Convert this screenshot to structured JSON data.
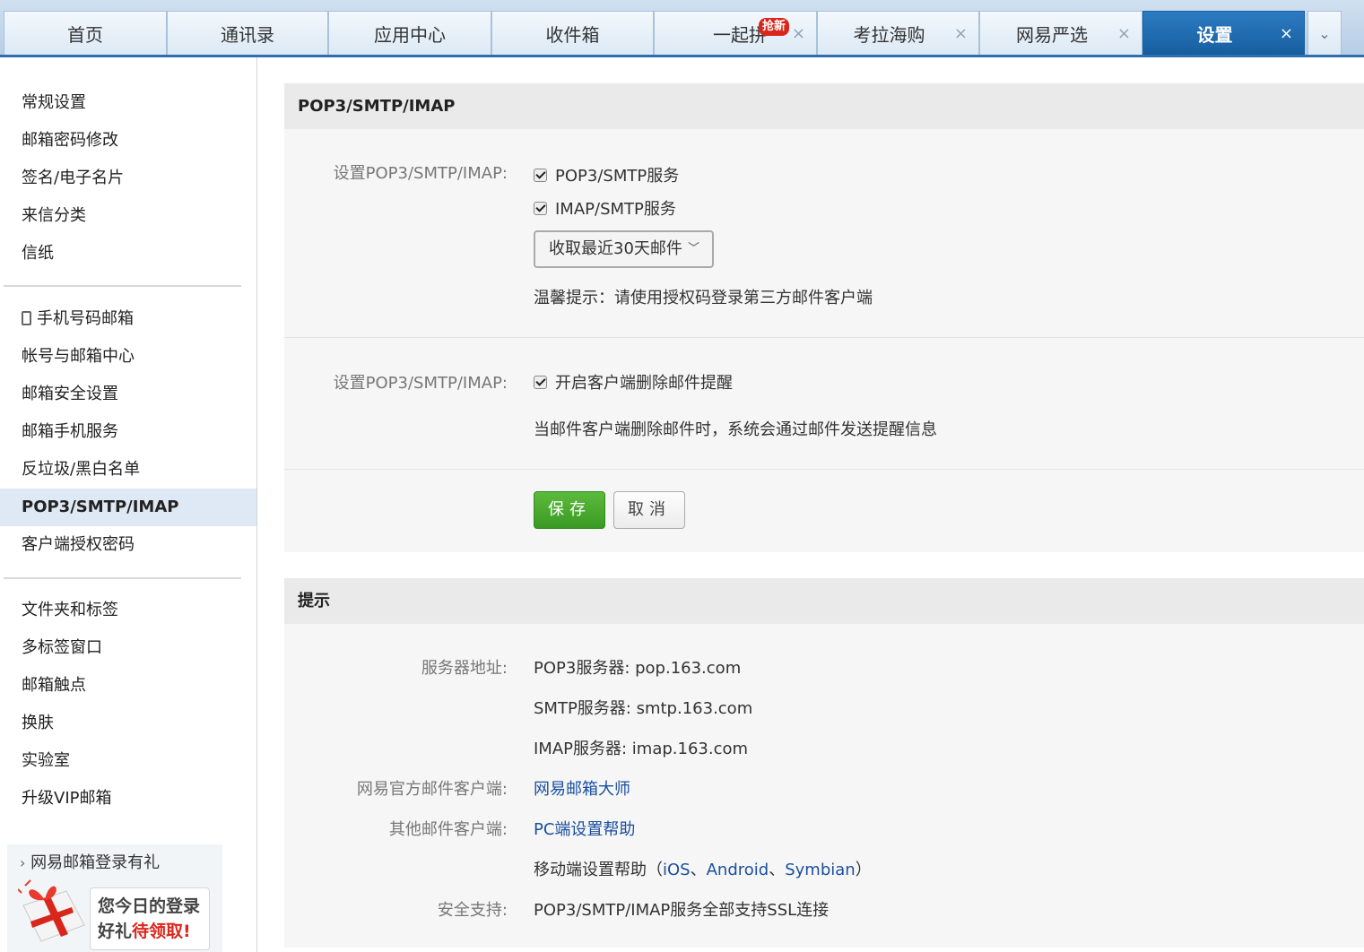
{
  "tabs": [
    {
      "label": "首页",
      "closable": false,
      "active": false
    },
    {
      "label": "通讯录",
      "closable": false,
      "active": false
    },
    {
      "label": "应用中心",
      "closable": false,
      "active": false
    },
    {
      "label": "收件箱",
      "closable": false,
      "active": false
    },
    {
      "label": "一起拼",
      "badge": "抢新",
      "closable": true,
      "active": false
    },
    {
      "label": "考拉海购",
      "closable": true,
      "active": false
    },
    {
      "label": "网易严选",
      "closable": true,
      "active": false
    },
    {
      "label": "设置",
      "closable": true,
      "active": true
    }
  ],
  "tab_close_glyph": "×",
  "tab_more_glyph": "⌄",
  "sidebar": {
    "group1": [
      "常规设置",
      "邮箱密码修改",
      "签名/电子名片",
      "来信分类",
      "信纸"
    ],
    "group2": [
      "手机号码邮箱",
      "帐号与邮箱中心",
      "邮箱安全设置",
      "邮箱手机服务",
      "反垃圾/黑白名单",
      "POP3/SMTP/IMAP",
      "客户端授权密码"
    ],
    "group3": [
      "文件夹和标签",
      "多标签窗口",
      "邮箱触点",
      "换肤",
      "实验室",
      "升级VIP邮箱"
    ],
    "active_item": "POP3/SMTP/IMAP",
    "promo": {
      "title": "网易邮箱登录有礼",
      "card_line1": "您今日的登录",
      "card_line2_a": "好礼",
      "card_line2_b": "待领取!"
    }
  },
  "settings": {
    "title": "POP3/SMTP/IMAP",
    "row1_label": "设置POP3/SMTP/IMAP:",
    "pop3_option": "POP3/SMTP服务",
    "imap_option": "IMAP/SMTP服务",
    "fetch_select": "收取最近30天邮件",
    "tip": "温馨提示：请使用授权码登录第三方邮件客户端",
    "row2_label": "设置POP3/SMTP/IMAP:",
    "delete_option": "开启客户端删除邮件提醒",
    "delete_desc": "当邮件客户端删除邮件时，系统会通过邮件发送提醒信息",
    "save": "保存",
    "cancel": "取消"
  },
  "hints": {
    "title": "提示",
    "server_label": "服务器地址:",
    "pop3_server": "POP3服务器: pop.163.com",
    "smtp_server": "SMTP服务器: smtp.163.com",
    "imap_server": "IMAP服务器: imap.163.com",
    "official_label": "网易官方邮件客户端:",
    "official_link": "网易邮箱大师",
    "other_label": "其他邮件客户端:",
    "pc_help": "PC端设置帮助",
    "mobile_help_prefix": "移动端设置帮助（",
    "ios": "iOS",
    "sep1": "、",
    "android": "Android",
    "sep2": "、",
    "symbian": "Symbian",
    "mobile_help_suffix": "）",
    "security_label": "安全支持:",
    "security_value": "POP3/SMTP/IMAP服务全部支持SSL连接"
  },
  "colors": {
    "accent": "#1f67ad",
    "save_green": "#46a62b",
    "link": "#1a4fa0",
    "badge_red": "#d9261c"
  }
}
